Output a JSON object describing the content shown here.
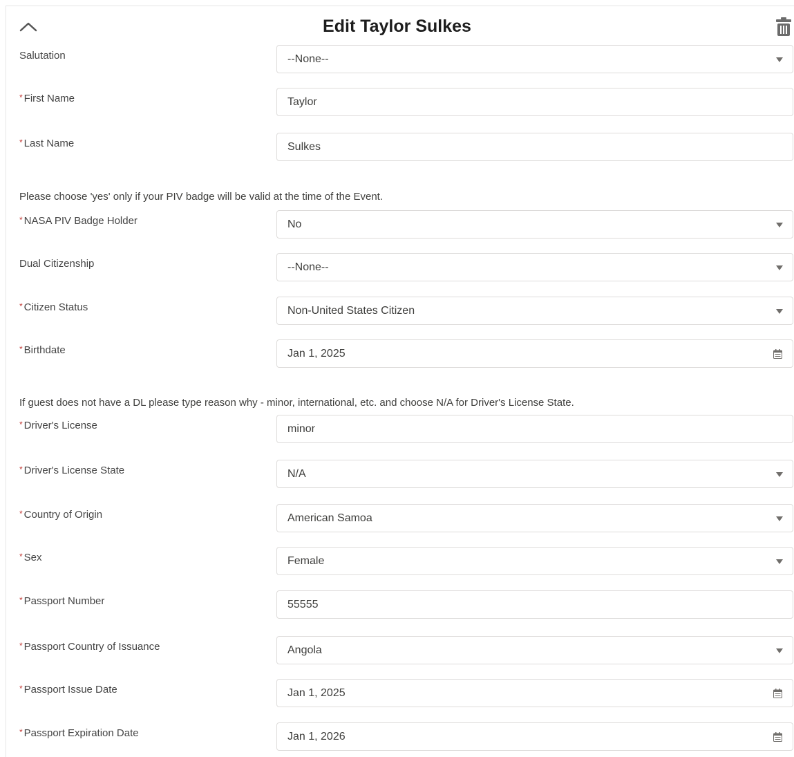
{
  "header": {
    "title": "Edit Taylor Sulkes",
    "collapse_icon": "chevron-up-icon",
    "delete_icon": "trash-icon"
  },
  "colors": {
    "required_asterisk": "#c23934",
    "field_border": "#dddbda",
    "label_text": "#444444"
  },
  "form": {
    "salutation": {
      "label": "Salutation",
      "value": "--None--"
    },
    "first_name": {
      "label": "First Name",
      "value": "Taylor"
    },
    "last_name": {
      "label": "Last Name",
      "value": "Sulkes"
    },
    "piv_help": "Please choose 'yes' only if your PIV badge will be valid at the time of the Event.",
    "nasa_piv": {
      "label": "NASA PIV Badge Holder",
      "value": "No"
    },
    "dual_citizenship": {
      "label": "Dual Citizenship",
      "value": "--None--"
    },
    "citizen_status": {
      "label": "Citizen Status",
      "value": "Non-United States Citizen"
    },
    "birthdate": {
      "label": "Birthdate",
      "value": "Jan 1, 2025"
    },
    "dl_help": "If guest does not have a DL please type reason why - minor, international, etc. and choose N/A for Driver's License State.",
    "drivers_license": {
      "label": "Driver's License",
      "value": "minor"
    },
    "dl_state": {
      "label": "Driver's License State",
      "value": "N/A"
    },
    "country_origin": {
      "label": "Country of Origin",
      "value": "American Samoa"
    },
    "sex": {
      "label": "Sex",
      "value": "Female"
    },
    "passport_number": {
      "label": "Passport Number",
      "value": "55555"
    },
    "passport_country": {
      "label": "Passport Country of Issuance",
      "value": "Angola"
    },
    "passport_issue": {
      "label": "Passport Issue Date",
      "value": "Jan 1, 2025"
    },
    "passport_expiration": {
      "label": "Passport Expiration Date",
      "value": "Jan 1, 2026"
    }
  }
}
